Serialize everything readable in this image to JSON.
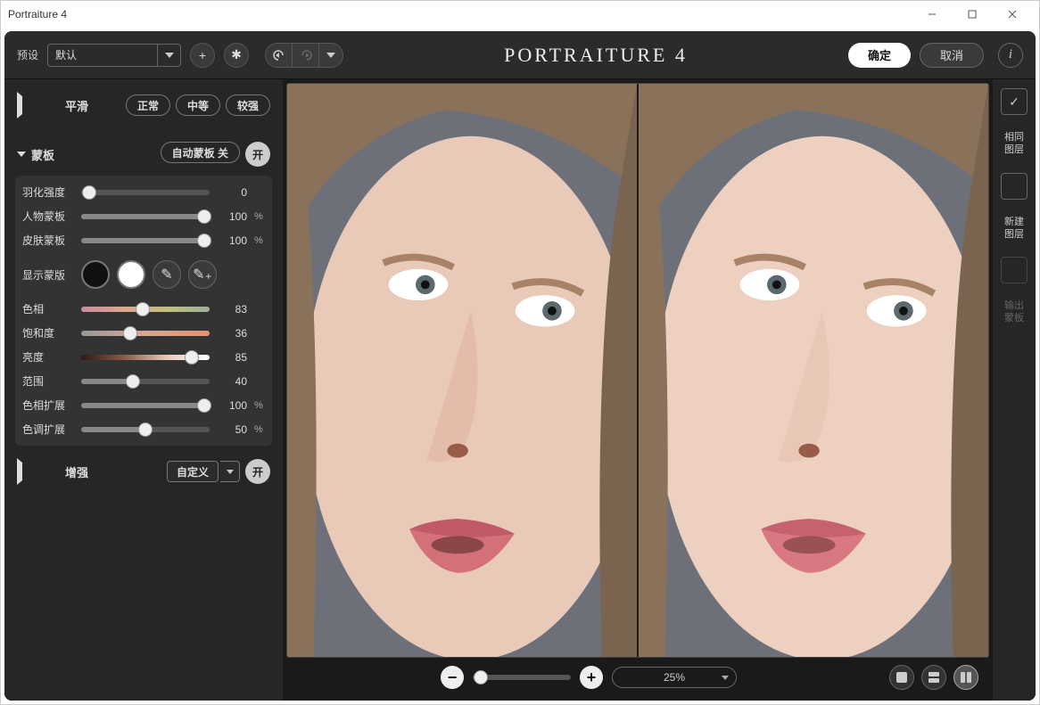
{
  "window": {
    "title": "Portraiture 4"
  },
  "topbar": {
    "preset_label": "预设",
    "preset_value": "默认",
    "app_title": "PORTRAITURE 4",
    "ok": "确定",
    "cancel": "取消"
  },
  "smooth": {
    "title": "平滑",
    "levels": [
      "正常",
      "中等",
      "较强"
    ]
  },
  "mask": {
    "title": "蒙板",
    "auto_label": "自动蒙板 关",
    "on": "开",
    "feather": {
      "label": "羽化强度",
      "value": 0,
      "pct": 0
    },
    "portrait": {
      "label": "人物蒙板",
      "value": 100,
      "pct": 100,
      "suffix": "%"
    },
    "skin": {
      "label": "皮肤蒙板",
      "value": 100,
      "pct": 100,
      "suffix": "%"
    },
    "show": "显示蒙版",
    "hue": {
      "label": "色相",
      "value": 83,
      "pct": 48
    },
    "sat": {
      "label": "饱和度",
      "value": 36,
      "pct": 38
    },
    "lum": {
      "label": "亮度",
      "value": 85,
      "pct": 86
    },
    "lat": {
      "label": "范围",
      "value": 40,
      "pct": 40
    },
    "hue_ext": {
      "label": "色相扩展",
      "value": 100,
      "pct": 100,
      "suffix": "%"
    },
    "tone_ext": {
      "label": "色调扩展",
      "value": 50,
      "pct": 50,
      "suffix": "%"
    }
  },
  "enhance": {
    "title": "增强",
    "mode": "自定义",
    "on": "开"
  },
  "zoom": {
    "label": "25%",
    "pct": 8
  },
  "right": {
    "same": "相同\n图层",
    "newl": "新建\n图层",
    "out": "输出\n蒙板"
  }
}
